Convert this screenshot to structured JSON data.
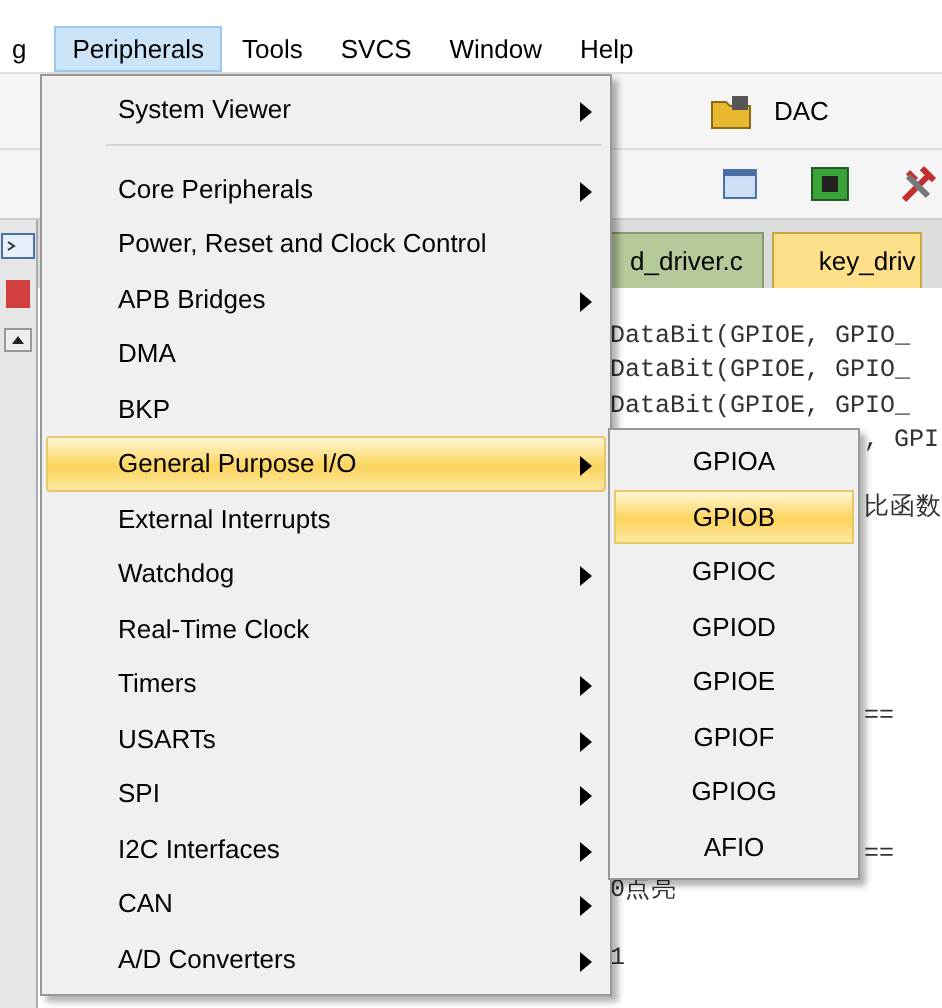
{
  "menubar": [
    {
      "label": "g",
      "selected": false
    },
    {
      "label": "Peripherals",
      "selected": true
    },
    {
      "label": "Tools",
      "selected": false
    },
    {
      "label": "SVCS",
      "selected": false
    },
    {
      "label": "Window",
      "selected": false
    },
    {
      "label": "Help",
      "selected": false
    }
  ],
  "toolbar": {
    "label": "DAC"
  },
  "tabs": [
    {
      "label": "d_driver.c",
      "selected": false
    },
    {
      "label": "key_driv",
      "selected": true
    }
  ],
  "menu": [
    {
      "kind": "item",
      "label": "System Viewer",
      "submenu": true,
      "selected": false
    },
    {
      "kind": "separator"
    },
    {
      "kind": "item",
      "label": "Core Peripherals",
      "submenu": true,
      "selected": false
    },
    {
      "kind": "item",
      "label": "Power, Reset and Clock Control",
      "submenu": false,
      "selected": false
    },
    {
      "kind": "item",
      "label": "APB Bridges",
      "submenu": true,
      "selected": false
    },
    {
      "kind": "item",
      "label": "DMA",
      "submenu": false,
      "selected": false
    },
    {
      "kind": "item",
      "label": "BKP",
      "submenu": false,
      "selected": false
    },
    {
      "kind": "item",
      "label": "General Purpose I/O",
      "submenu": true,
      "selected": true
    },
    {
      "kind": "item",
      "label": "External Interrupts",
      "submenu": false,
      "selected": false
    },
    {
      "kind": "item",
      "label": "Watchdog",
      "submenu": true,
      "selected": false
    },
    {
      "kind": "item",
      "label": "Real-Time Clock",
      "submenu": false,
      "selected": false
    },
    {
      "kind": "item",
      "label": "Timers",
      "submenu": true,
      "selected": false
    },
    {
      "kind": "item",
      "label": "USARTs",
      "submenu": true,
      "selected": false
    },
    {
      "kind": "item",
      "label": "SPI",
      "submenu": true,
      "selected": false
    },
    {
      "kind": "item",
      "label": "I2C Interfaces",
      "submenu": true,
      "selected": false
    },
    {
      "kind": "item",
      "label": "CAN",
      "submenu": true,
      "selected": false
    },
    {
      "kind": "item",
      "label": "A/D Converters",
      "submenu": true,
      "selected": false
    }
  ],
  "submenu": [
    {
      "label": "GPIOA",
      "selected": false
    },
    {
      "label": "GPIOB",
      "selected": true
    },
    {
      "label": "GPIOC",
      "selected": false
    },
    {
      "label": "GPIOD",
      "selected": false
    },
    {
      "label": "GPIOE",
      "selected": false
    },
    {
      "label": "GPIOF",
      "selected": false
    },
    {
      "label": "GPIOG",
      "selected": false
    },
    {
      "label": "AFIO",
      "selected": false
    }
  ],
  "code": [
    {
      "kind": "full",
      "text": "DataBit(GPIOE, GPIO_"
    },
    {
      "kind": "full",
      "text": "DataBit(GPIOE, GPIO_"
    },
    {
      "kind": "full",
      "text": "DataBit(GPIOE, GPIO_"
    },
    {
      "kind": "beside",
      "text": ", GPI"
    },
    {
      "kind": "blank"
    },
    {
      "kind": "beside",
      "text": "比函数"
    },
    {
      "kind": "blank"
    },
    {
      "kind": "blank"
    },
    {
      "kind": "blank"
    },
    {
      "kind": "blank"
    },
    {
      "kind": "blank"
    },
    {
      "kind": "beside",
      "text": "=="
    },
    {
      "kind": "blank"
    },
    {
      "kind": "blank"
    },
    {
      "kind": "blank"
    },
    {
      "kind": "beside",
      "text": "=="
    },
    {
      "kind": "full",
      "text": "0点亮"
    },
    {
      "kind": "blank"
    },
    {
      "kind": "full",
      "text": "1"
    }
  ]
}
